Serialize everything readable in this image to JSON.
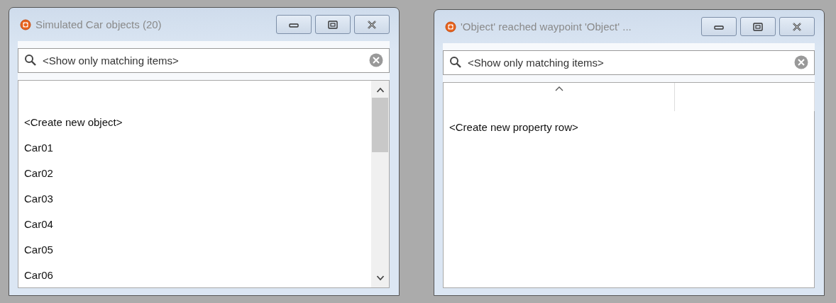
{
  "windows": [
    {
      "title": "Simulated Car objects (20)",
      "search": {
        "placeholder": "<Show only matching items>"
      },
      "kind": "list",
      "items": [
        "<Create new object>",
        "Car01",
        "Car02",
        "Car03",
        "Car04",
        "Car05",
        "Car06"
      ]
    },
    {
      "title": "'Object' reached waypoint 'Object' ...",
      "search": {
        "placeholder": "<Show only matching items>"
      },
      "kind": "table",
      "items": [
        "<Create new property row>"
      ]
    }
  ]
}
